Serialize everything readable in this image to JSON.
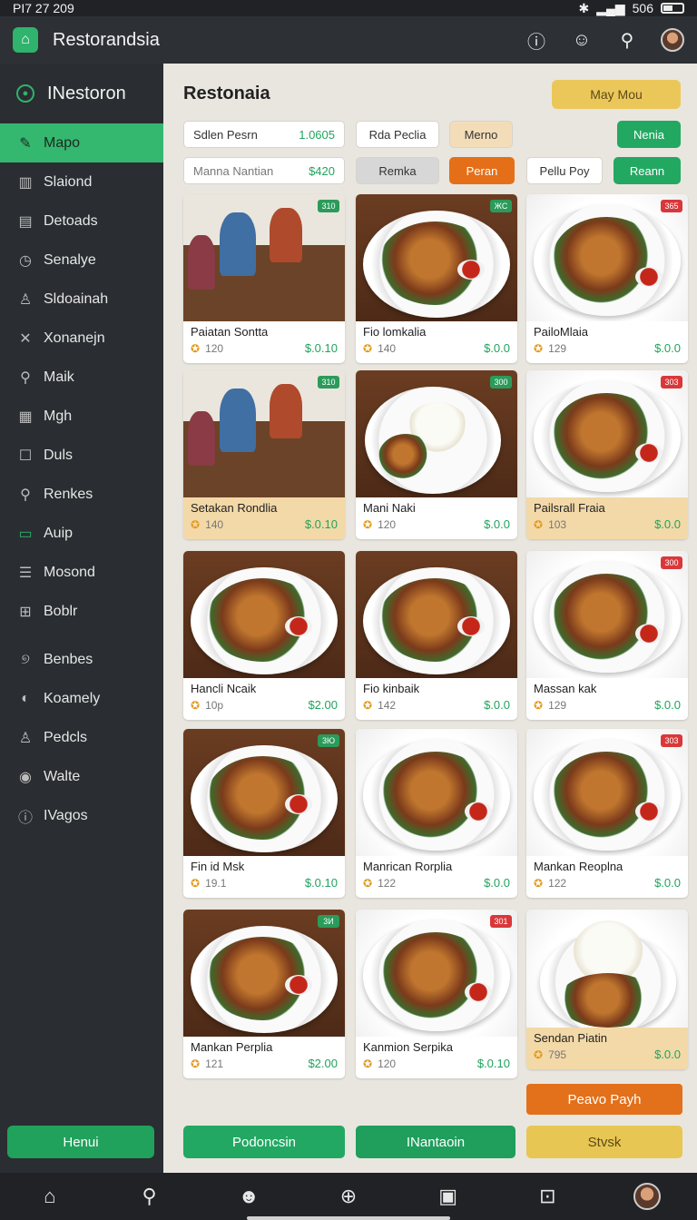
{
  "status": {
    "time": "PI7 27 209",
    "right_text": "506"
  },
  "app": {
    "title": "Restorandsia"
  },
  "sidebar": {
    "brand": "INestoron",
    "items": [
      {
        "label": "Mapo",
        "icon": "pencil-icon"
      },
      {
        "label": "Slaiond",
        "icon": "chart-icon"
      },
      {
        "label": "Detoads",
        "icon": "book-icon"
      },
      {
        "label": "Senalye",
        "icon": "clock-icon"
      },
      {
        "label": "Sldoainah",
        "icon": "user-icon"
      },
      {
        "label": "Xonanejn",
        "icon": "tools-icon"
      },
      {
        "label": "Maik",
        "icon": "search-icon"
      },
      {
        "label": "Mgh",
        "icon": "grid-icon"
      },
      {
        "label": "Duls",
        "icon": "square-icon"
      },
      {
        "label": "Renkes",
        "icon": "pin-icon"
      },
      {
        "label": "Auip",
        "icon": "panel-icon"
      },
      {
        "label": "Mosond",
        "icon": "list-icon"
      },
      {
        "label": "Boblr",
        "icon": "cart-icon"
      },
      {
        "label": "Benbes",
        "icon": "swirl-icon"
      },
      {
        "label": "Koamely",
        "icon": "drop-icon"
      },
      {
        "label": "Pedcls",
        "icon": "person-icon"
      },
      {
        "label": "Walte",
        "icon": "eye-icon"
      },
      {
        "label": "IVagos",
        "icon": "info-icon"
      }
    ],
    "button": "Henui"
  },
  "main": {
    "title": "Restonaia",
    "top_cta": "May Mou",
    "row1": [
      {
        "label": "Sdlen Pesrn",
        "value": "1.0605"
      },
      {
        "label": "Rda Peclia"
      },
      {
        "label": "Merno"
      },
      {
        "label": "Nenia"
      }
    ],
    "row2": [
      {
        "label": "Manna Nantian",
        "value": "$420"
      },
      {
        "label": "Remka"
      },
      {
        "label": "Peran"
      },
      {
        "label": "Pellu Poy"
      },
      {
        "label": "Reann"
      }
    ],
    "cards": [
      {
        "name": "Paiatan Sontta",
        "rating": "120",
        "price": "$.0.10",
        "badge": "310",
        "photo": "people"
      },
      {
        "name": "Fio lomkalia",
        "rating": "140",
        "price": "$.0.0",
        "badge": "ЖС",
        "photo": "dish"
      },
      {
        "name": "PailoMlaia",
        "rating": "129",
        "price": "$.0.0",
        "badge": "365",
        "photo": "dish-white"
      },
      {
        "name": "Setakan Rondlia",
        "rating": "140",
        "price": "$.0.10",
        "badge": "310",
        "photo": "people"
      },
      {
        "name": "Mani Naki",
        "rating": "120",
        "price": "$.0.0",
        "badge": "300",
        "photo": "rice"
      },
      {
        "name": "Pailsrall Fraia",
        "rating": "103",
        "price": "$.0.0",
        "badge": "303",
        "photo": "dish-white"
      },
      {
        "name": "Hancli Ncaik",
        "rating": "10p",
        "price": "$2.00",
        "badge": "",
        "photo": "dish"
      },
      {
        "name": "Fio kinbaik",
        "rating": "142",
        "price": "$.0.0",
        "badge": "",
        "photo": "dish"
      },
      {
        "name": "Massan kak",
        "rating": "129",
        "price": "$.0.0",
        "badge": "300",
        "photo": "dish-white"
      },
      {
        "name": "Fin id Msk",
        "rating": "19.1",
        "price": "$.0.10",
        "badge": "3Ю",
        "photo": "dish"
      },
      {
        "name": "Manrican Rorplia",
        "rating": "122",
        "price": "$.0.0",
        "badge": "",
        "photo": "dish-white"
      },
      {
        "name": "Mankan Reoplna",
        "rating": "122",
        "price": "$.0.0",
        "badge": "303",
        "photo": "dish-white"
      },
      {
        "name": "Mankan Perplia",
        "rating": "121",
        "price": "$2.00",
        "badge": "3И",
        "photo": "dish"
      },
      {
        "name": "Kanmion Serpika",
        "rating": "120",
        "price": "$.0.10",
        "badge": "301",
        "photo": "dish-white"
      },
      {
        "name": "Sendan Piatin",
        "rating": "795",
        "price": "$.0.0",
        "badge": "",
        "photo": "rice-white"
      }
    ],
    "order_button": "Peavo Payh",
    "bottom_buttons": [
      "Podoncsin",
      "INantaoin",
      "Stvsk"
    ]
  },
  "colors": {
    "accent_green": "#23a862",
    "accent_orange": "#e56f18",
    "accent_yellow": "#ebc75a",
    "sidebar_bg": "#2a2d31"
  }
}
